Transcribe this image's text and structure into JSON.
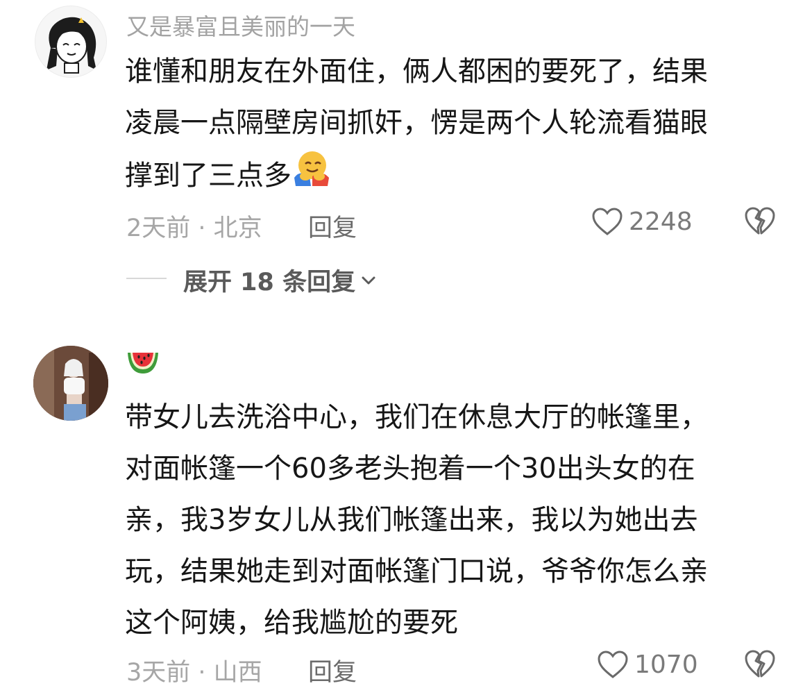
{
  "comments": [
    {
      "username": "又是暴富且美丽的一天",
      "lines": [
        "谁懂和朋友在外面住，俩人都困的要死了，结果",
        "凌晨一点隔壁房间抓奸，愣是两个人轮流看猫眼",
        "撑到了三点多"
      ],
      "emoji": "hugging-face-icon",
      "meta": "2天前 · 北京",
      "reply_label": "回复",
      "likes": "2248",
      "expand_label": "展开 18 条回复"
    },
    {
      "username": "",
      "username_emoji": "watermelon-icon",
      "lines": [
        "带女儿去洗浴中心，我们在休息大厅的帐篷里，",
        "对面帐篷一个60多老头抱着一个30出头女的在",
        "亲，我3岁女儿从我们帐篷出来，我以为她出去",
        "玩，结果她走到对面帐篷门口说，爷爷你怎么亲",
        "这个阿姨，给我尴尬的要死"
      ],
      "meta": "3天前 · 山西",
      "reply_label": "回复",
      "likes": "1070"
    }
  ],
  "colors": {
    "text": "#161616",
    "muted": "#a6a6a6",
    "icon": "#5f5f5f"
  }
}
